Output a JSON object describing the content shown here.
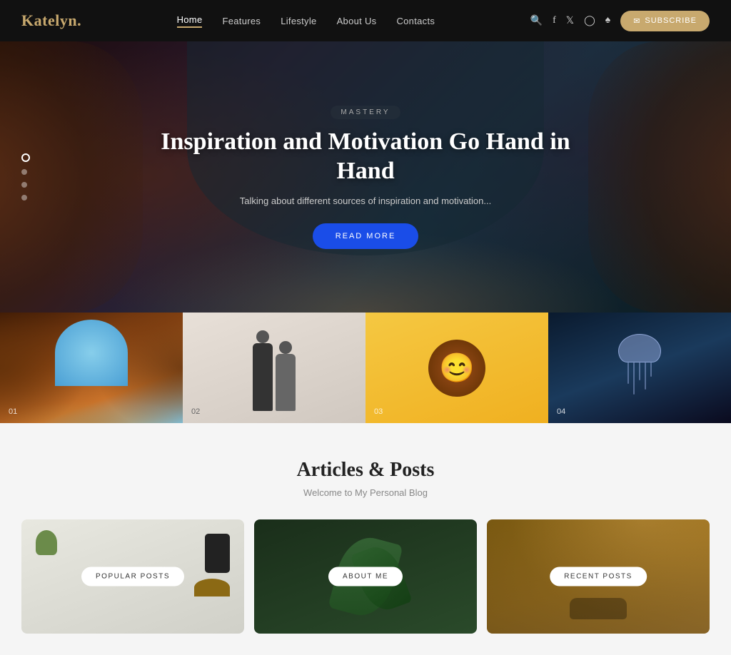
{
  "header": {
    "logo": "Katelyn",
    "logo_dot": ".",
    "nav": {
      "items": [
        {
          "label": "Home",
          "active": true
        },
        {
          "label": "Features",
          "active": false
        },
        {
          "label": "Lifestyle",
          "active": false
        },
        {
          "label": "About Us",
          "active": false
        },
        {
          "label": "Contacts",
          "active": false
        }
      ]
    },
    "subscribe_label": "SUBSCRIBE"
  },
  "hero": {
    "category": "MASTERY",
    "title": "Inspiration and Motivation Go Hand in Hand",
    "subtitle": "Talking about different sources of inspiration and motivation...",
    "cta": "READ MORE",
    "dots": [
      {
        "active": true
      },
      {
        "active": false
      },
      {
        "active": false
      },
      {
        "active": false
      }
    ]
  },
  "thumbnails": [
    {
      "number": "01"
    },
    {
      "number": "02"
    },
    {
      "number": "03"
    },
    {
      "number": "04"
    }
  ],
  "articles": {
    "title": "Articles & Posts",
    "subtitle": "Welcome to My Personal Blog",
    "cards": [
      {
        "label": "POPULAR POSTS"
      },
      {
        "label": "ABOUT ME"
      },
      {
        "label": "RECENT POSTS"
      }
    ]
  }
}
